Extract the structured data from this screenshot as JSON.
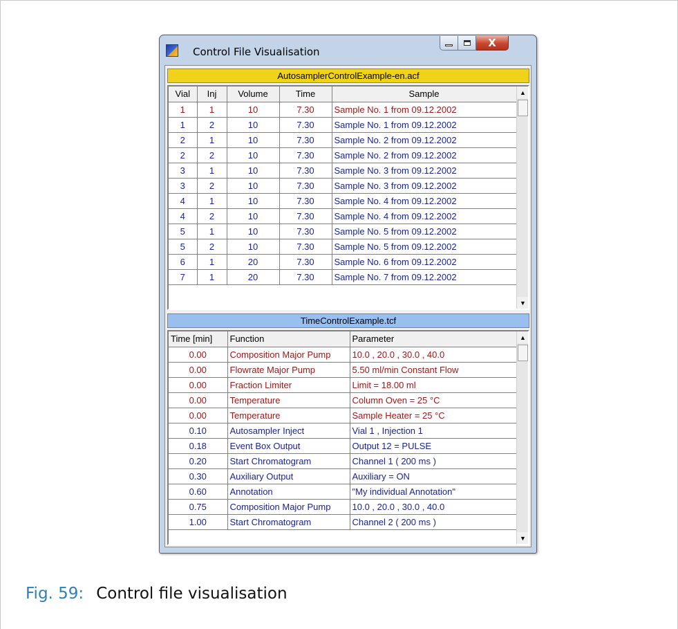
{
  "window": {
    "title": "Control File Visualisation",
    "icons": {
      "app": "app-icon",
      "minimize": "minimize-icon",
      "maximize": "maximize-icon",
      "close": "close-icon"
    },
    "close_glyph": "X"
  },
  "autosampler": {
    "filename": "AutosamplerControlExample-en.acf",
    "columns": [
      "Vial",
      "Inj",
      "Volume",
      "Time",
      "Sample"
    ],
    "rows": [
      {
        "vial": "1",
        "inj": "1",
        "volume": "10",
        "time": "7.30",
        "sample": "Sample No. 1 from 09.12.2002",
        "color": "red"
      },
      {
        "vial": "1",
        "inj": "2",
        "volume": "10",
        "time": "7.30",
        "sample": "Sample No. 1 from 09.12.2002",
        "color": "blue"
      },
      {
        "vial": "2",
        "inj": "1",
        "volume": "10",
        "time": "7.30",
        "sample": "Sample No. 2 from 09.12.2002",
        "color": "blue"
      },
      {
        "vial": "2",
        "inj": "2",
        "volume": "10",
        "time": "7.30",
        "sample": "Sample No. 2 from 09.12.2002",
        "color": "blue"
      },
      {
        "vial": "3",
        "inj": "1",
        "volume": "10",
        "time": "7.30",
        "sample": "Sample No. 3 from 09.12.2002",
        "color": "blue"
      },
      {
        "vial": "3",
        "inj": "2",
        "volume": "10",
        "time": "7.30",
        "sample": "Sample No. 3 from 09.12.2002",
        "color": "blue"
      },
      {
        "vial": "4",
        "inj": "1",
        "volume": "10",
        "time": "7.30",
        "sample": "Sample No. 4 from 09.12.2002",
        "color": "blue"
      },
      {
        "vial": "4",
        "inj": "2",
        "volume": "10",
        "time": "7.30",
        "sample": "Sample No. 4 from 09.12.2002",
        "color": "blue"
      },
      {
        "vial": "5",
        "inj": "1",
        "volume": "10",
        "time": "7.30",
        "sample": "Sample No. 5 from 09.12.2002",
        "color": "blue"
      },
      {
        "vial": "5",
        "inj": "2",
        "volume": "10",
        "time": "7.30",
        "sample": "Sample No. 5 from 09.12.2002",
        "color": "blue"
      },
      {
        "vial": "6",
        "inj": "1",
        "volume": "20",
        "time": "7.30",
        "sample": "Sample No. 6 from 09.12.2002",
        "color": "blue"
      },
      {
        "vial": "7",
        "inj": "1",
        "volume": "20",
        "time": "7.30",
        "sample": "Sample No. 7 from 09.12.2002",
        "color": "blue"
      }
    ]
  },
  "timecontrol": {
    "filename": "TimeControlExample.tcf",
    "columns": [
      "Time [min]",
      "Function",
      "Parameter"
    ],
    "rows": [
      {
        "time": "0.00",
        "function": "Composition Major Pump",
        "parameter": "10.0  ,  20.0  ,  30.0  ,  40.0",
        "color": "red"
      },
      {
        "time": "0.00",
        "function": "Flowrate Major Pump",
        "parameter": "5.50  ml/min Constant Flow",
        "color": "red"
      },
      {
        "time": "0.00",
        "function": "Fraction Limiter",
        "parameter": "Limit = 18.00 ml",
        "color": "red"
      },
      {
        "time": "0.00",
        "function": "Temperature",
        "parameter": "Column Oven = 25 °C",
        "color": "red"
      },
      {
        "time": "0.00",
        "function": "Temperature",
        "parameter": "Sample Heater = 25 °C",
        "color": "red"
      },
      {
        "time": "0.10",
        "function": "Autosampler Inject",
        "parameter": "Vial 1 , Injection 1",
        "color": "blue"
      },
      {
        "time": "0.18",
        "function": "Event Box Output",
        "parameter": "Output 12 = PULSE",
        "color": "blue"
      },
      {
        "time": "0.20",
        "function": "Start Chromatogram",
        "parameter": "Channel 1 ( 200 ms )",
        "color": "blue"
      },
      {
        "time": "0.30",
        "function": "Auxiliary Output",
        "parameter": "Auxiliary = ON",
        "color": "blue"
      },
      {
        "time": "0.60",
        "function": "Annotation",
        "parameter": "\"My individual Annotation\"",
        "color": "blue"
      },
      {
        "time": "0.75",
        "function": "Composition Major Pump",
        "parameter": "10.0  ,  20.0  ,  30.0  ,  40.0",
        "color": "blue"
      },
      {
        "time": "1.00",
        "function": "Start Chromatogram",
        "parameter": "Channel 2 ( 200 ms )",
        "color": "blue"
      }
    ]
  },
  "scrollbar": {
    "up_glyph": "▲",
    "down_glyph": "▼"
  },
  "caption": {
    "label": "Fig. 59:",
    "text": "Control file visualisation"
  }
}
